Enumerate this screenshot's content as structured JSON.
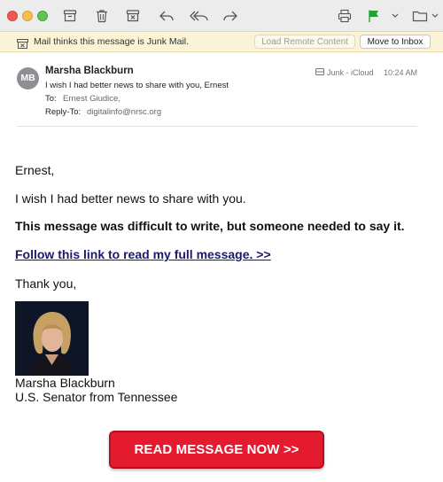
{
  "toolbar": {
    "window_controls": [
      "close",
      "minimize",
      "zoom"
    ],
    "buttons": [
      {
        "icon": "archive-icon"
      },
      {
        "icon": "trash-icon"
      },
      {
        "icon": "junk-icon"
      },
      {
        "icon": "reply-icon"
      },
      {
        "icon": "reply-all-icon"
      },
      {
        "icon": "forward-icon"
      },
      {
        "icon": "print-icon"
      },
      {
        "icon": "flag-icon",
        "color": "#22a434"
      },
      {
        "icon": "flag-menu-chevron-icon"
      },
      {
        "icon": "move-folder-icon"
      },
      {
        "icon": "move-menu-chevron-icon"
      }
    ]
  },
  "junk_banner": {
    "message": "Mail thinks this message is Junk Mail.",
    "load_remote_label": "Load Remote Content",
    "move_to_inbox_label": "Move to Inbox",
    "background": "#fbf3d5"
  },
  "header": {
    "avatar_initials": "MB",
    "sender": "Marsha Blackburn",
    "subject": "I wish I had better news to share with you, Ernest",
    "to_label": "To:",
    "to_value": "Ernest Giudice,",
    "reply_to_label": "Reply-To:",
    "reply_to_value": "digitalinfo@nrsc.org",
    "mailbox": "Junk - iCloud",
    "time": "10:24 AM"
  },
  "body": {
    "greeting": "Ernest,",
    "line1": "I wish I had better news to share with you.",
    "line2": "This message was difficult to write, but someone needed to say it.",
    "link_text": "Follow this link to read my full message. >>",
    "closing": "Thank you,",
    "signature_name": "Marsha Blackburn",
    "signature_title": "U.S. Senator from Tennessee",
    "cta_label": "READ MESSAGE NOW >>",
    "cta_color": "#e41b2f",
    "link_color": "#191970"
  }
}
